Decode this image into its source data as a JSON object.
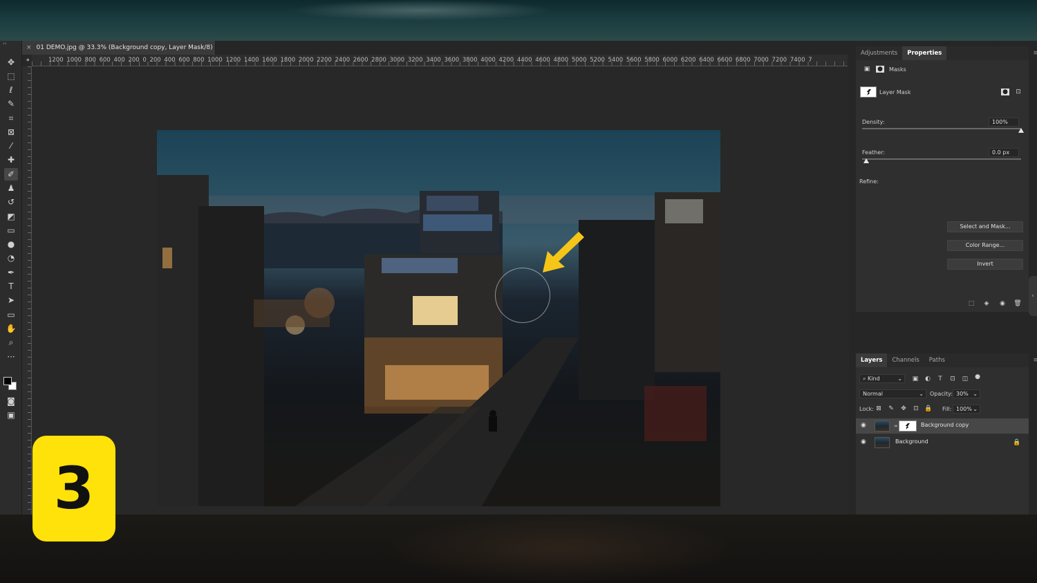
{
  "document": {
    "tab_title": "01 DEMO.jpg @ 33.3% (Background copy, Layer Mask/8) *",
    "close_glyph": "×"
  },
  "ruler": {
    "horizontal_labels": "1200 1000 800 600 400 200 0 200 400 600 800 1000 1200 1400 1600 1800 2000 2200 2400 2600 2800 3000 3200 3400 3600 3800 4000 4200 4400 4600 4800 5000 5200 5400 5600 5800 6000 6200 6400 6600 6800 7000 7200 7400 7",
    "vertical_labels": [
      "0",
      "0",
      "0",
      "0",
      "0",
      "0",
      "0",
      "0",
      "0",
      "0",
      "0",
      "0",
      "0",
      "0"
    ]
  },
  "properties_panel": {
    "tabs": [
      {
        "label": "Adjustments",
        "active": false
      },
      {
        "label": "Properties",
        "active": true
      }
    ],
    "section_label": "Masks",
    "layer_mask_label": "Layer Mask",
    "density": {
      "label": "Density:",
      "value": "100%",
      "fraction": 1.0
    },
    "feather": {
      "label": "Feather:",
      "value": "0.0 px",
      "fraction": 0.0
    },
    "refine_label": "Refine:",
    "buttons": [
      "Select and Mask...",
      "Color Range...",
      "Invert"
    ]
  },
  "layers_panel": {
    "tabs": [
      {
        "label": "Layers",
        "active": true
      },
      {
        "label": "Channels",
        "active": false
      },
      {
        "label": "Paths",
        "active": false
      }
    ],
    "filter_label": "Kind",
    "blend_mode": "Normal",
    "opacity": {
      "label": "Opacity:",
      "value": "30%"
    },
    "lock_label": "Lock:",
    "fill": {
      "label": "Fill:",
      "value": "100%"
    },
    "layers": [
      {
        "name": "Background copy",
        "selected": true,
        "has_mask": true,
        "locked": false
      },
      {
        "name": "Background",
        "selected": false,
        "has_mask": false,
        "locked": true
      }
    ]
  },
  "overlay": {
    "step_number": "3"
  },
  "colors": {
    "panel_bg": "#2f2f2f",
    "canvas_bg": "#282828",
    "badge_yellow": "#ffe20a",
    "arrow_yellow": "#f5c518"
  },
  "icons": {
    "tools": [
      "move-icon",
      "marquee-icon",
      "lasso-icon",
      "quick-select-icon",
      "crop-icon",
      "frame-icon",
      "eyedropper-icon",
      "healing-icon",
      "brush-icon",
      "stamp-icon",
      "history-brush-icon",
      "eraser-icon",
      "gradient-icon",
      "blur-icon",
      "dodge-icon",
      "pen-icon",
      "type-icon",
      "path-select-icon",
      "rectangle-icon",
      "hand-icon",
      "zoom-icon",
      "more-icon"
    ]
  }
}
